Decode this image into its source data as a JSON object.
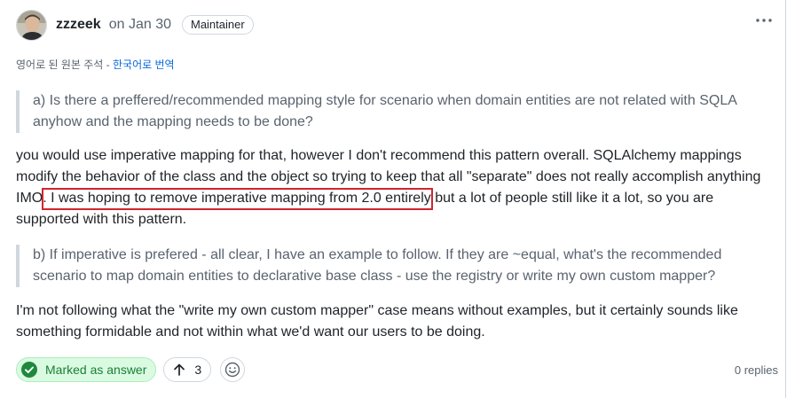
{
  "comment": {
    "author": "zzzeek",
    "date": "on Jan 30",
    "badge": "Maintainer"
  },
  "translation": {
    "note": "영어로 된 원본 주석",
    "separator": " - ",
    "link": "한국어로 번역"
  },
  "body": {
    "quote1": "a) Is there a preffered/recommended mapping style for scenario when domain entities are not related with SQLA anyhow and the mapping needs to be done?",
    "para1": "you would use imperative mapping for that, however I don't recommend this pattern overall. SQLAlchemy mappings modify the behavior of the class and the object so trying to keep that all \"separate\" does not really accomplish anything IMO. I was hoping to remove imperative mapping from 2.0 entirely but a lot of people still like it a lot, so you are supported with this pattern.",
    "quote2": "b) If imperative is prefered - all clear, I have an example to follow. If they are ~equal, what's the recommended scenario to map domain entities to declarative base class - use the registry or write my own custom mapper?",
    "para2": "I'm not following what the \"write my own custom mapper\" case means without examples, but it certainly sounds like something formidable and not within what we'd want our users to be doing."
  },
  "footer": {
    "answer_label": "Marked as answer",
    "upvotes": "3",
    "replies": "0 replies"
  },
  "colors": {
    "highlight_box": "#d1242f",
    "answer_green": "#1a7f37",
    "link_blue": "#0969da"
  },
  "icons": [
    "avatar",
    "kebab-horizontal-icon",
    "check-circle-icon",
    "arrow-up-icon",
    "smiley-icon"
  ]
}
